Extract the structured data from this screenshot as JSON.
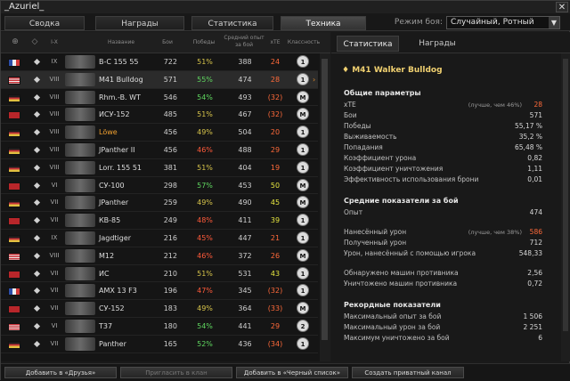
{
  "window": {
    "title": "_Azuriel_",
    "close_label": "✕"
  },
  "tabs": [
    {
      "label": "Сводка"
    },
    {
      "label": "Награды"
    },
    {
      "label": "Статистика"
    },
    {
      "label": "Техника"
    }
  ],
  "mode": {
    "label": "Режим боя:",
    "value": "Случайный, Ротный"
  },
  "columns": {
    "nation": "⊕",
    "type": "◇",
    "tier": "I-X",
    "name": "Название",
    "battles": "Бои",
    "wins": "Победы",
    "exp": "Средний опыт за бой",
    "xte": "xTE",
    "class": "Классность"
  },
  "rows": [
    {
      "flag": "fr",
      "tier": "IX",
      "name": "B-C 155 55",
      "battles": "722",
      "wins": "51%",
      "wins_color": "#d6c34a",
      "exp": "388",
      "xte": "24",
      "xte_color": "#ff6a3a",
      "badge": "1"
    },
    {
      "flag": "us",
      "tier": "VIII",
      "name": "M41 Bulldog",
      "battles": "571",
      "wins": "55%",
      "wins_color": "#5fd65f",
      "exp": "474",
      "xte": "28",
      "xte_color": "#ff6a3a",
      "badge": "1",
      "selected": true,
      "arrow": "›"
    },
    {
      "flag": "de",
      "tier": "VIII",
      "name": "Rhm.-B. WT",
      "battles": "546",
      "wins": "54%",
      "wins_color": "#5fd65f",
      "exp": "493",
      "xte": "32",
      "xte_color": "#ff6a3a",
      "badge": "M"
    },
    {
      "flag": "su",
      "tier": "VIII",
      "name": "ИСУ-152",
      "battles": "485",
      "wins": "51%",
      "wins_color": "#d6c34a",
      "exp": "467",
      "xte": "32",
      "xte_color": "#ff6a3a",
      "badge": "M"
    },
    {
      "flag": "de",
      "tier": "VIII",
      "name": "Löwe",
      "battles": "456",
      "wins": "49%",
      "wins_color": "#d6c34a",
      "exp": "504",
      "xte": "20",
      "xte_color": "#ff6a3a",
      "badge": "1",
      "name_color": "#f0a030"
    },
    {
      "flag": "de",
      "tier": "VIII",
      "name": "JPanther II",
      "battles": "456",
      "wins": "46%",
      "wins_color": "#ff5a3a",
      "exp": "488",
      "xte": "29",
      "xte_color": "#ff6a3a",
      "badge": "1"
    },
    {
      "flag": "de",
      "tier": "VIII",
      "name": "Lorr. 155 51",
      "battles": "381",
      "wins": "51%",
      "wins_color": "#d6c34a",
      "exp": "404",
      "xte": "19",
      "xte_color": "#ff6a3a",
      "badge": "1"
    },
    {
      "flag": "su",
      "tier": "VI",
      "name": "СУ-100",
      "battles": "298",
      "wins": "57%",
      "wins_color": "#5fd65f",
      "exp": "453",
      "xte": "50",
      "xte_color": "#e6e640",
      "badge": "M"
    },
    {
      "flag": "de",
      "tier": "VII",
      "name": "JPanther",
      "battles": "259",
      "wins": "49%",
      "wins_color": "#d6c34a",
      "exp": "490",
      "xte": "45",
      "xte_color": "#e6e640",
      "badge": "M"
    },
    {
      "flag": "su",
      "tier": "VII",
      "name": "КВ-85",
      "battles": "249",
      "wins": "48%",
      "wins_color": "#ff5a3a",
      "exp": "411",
      "xte": "39",
      "xte_color": "#e6e640",
      "badge": "1"
    },
    {
      "flag": "de",
      "tier": "IX",
      "name": "Jagdtiger",
      "battles": "216",
      "wins": "45%",
      "wins_color": "#ff5a3a",
      "exp": "447",
      "xte": "21",
      "xte_color": "#ff6a3a",
      "badge": "1"
    },
    {
      "flag": "us",
      "tier": "VIII",
      "name": "M12",
      "battles": "212",
      "wins": "46%",
      "wins_color": "#ff5a3a",
      "exp": "372",
      "xte": "26",
      "xte_color": "#ff6a3a",
      "badge": "M"
    },
    {
      "flag": "su",
      "tier": "VII",
      "name": "ИС",
      "battles": "210",
      "wins": "51%",
      "wins_color": "#d6c34a",
      "exp": "531",
      "xte": "43",
      "xte_color": "#e6e640",
      "badge": "1"
    },
    {
      "flag": "fr",
      "tier": "VII",
      "name": "AMX 13 F3",
      "battles": "196",
      "wins": "47%",
      "wins_color": "#ff5a3a",
      "exp": "345",
      "xte": "32",
      "xte_color": "#ff6a3a",
      "badge": "1"
    },
    {
      "flag": "su",
      "tier": "VII",
      "name": "СУ-152",
      "battles": "183",
      "wins": "49%",
      "wins_color": "#d6c34a",
      "exp": "364",
      "xte": "33",
      "xte_color": "#ff6a3a",
      "badge": "M"
    },
    {
      "flag": "us",
      "tier": "VI",
      "name": "T37",
      "battles": "180",
      "wins": "54%",
      "wins_color": "#5fd65f",
      "exp": "441",
      "xte": "29",
      "xte_color": "#ff6a3a",
      "badge": "2"
    },
    {
      "flag": "de",
      "tier": "VII",
      "name": "Panther",
      "battles": "165",
      "wins": "52%",
      "wins_color": "#5fd65f",
      "exp": "436",
      "xte": "34",
      "xte_color": "#ff6a3a",
      "badge": "1"
    }
  ],
  "right": {
    "tabs": [
      {
        "label": "Статистика"
      },
      {
        "label": "Награды"
      }
    ],
    "vehicle": "M41 Walker Bulldog",
    "general": {
      "title": "Общие параметры",
      "items": [
        {
          "label": "xTE",
          "note": "(лучше, чем 46%)",
          "value": "28",
          "value_color": "#ff6a3a"
        },
        {
          "label": "Бои",
          "note": "",
          "value": "571"
        },
        {
          "label": "Победы",
          "note": "",
          "value": "55,17 %"
        },
        {
          "label": "Выживаемость",
          "note": "",
          "value": "35,2 %"
        },
        {
          "label": "Попадания",
          "note": "",
          "value": "65,48 %"
        },
        {
          "label": "Коэффициент урона",
          "note": "",
          "value": "0,82"
        },
        {
          "label": "Коэффициент уничтожения",
          "note": "",
          "value": "1,11"
        },
        {
          "label": "Эффективность использования брони",
          "note": "",
          "value": "0,01"
        }
      ]
    },
    "avg": {
      "title": "Средние показатели за бой",
      "items": [
        {
          "label": "Опыт",
          "note": "",
          "value": "474"
        },
        {
          "label": "Нанесённый урон",
          "note": "(лучше, чем 38%)",
          "value": "586",
          "value_color": "#ff6a3a"
        },
        {
          "label": "Полученный урон",
          "note": "",
          "value": "712"
        },
        {
          "label": "Урон, нанесённый с помощью игрока",
          "note": "",
          "value": "548,33"
        },
        {
          "label": "Обнаружено машин противника",
          "note": "",
          "value": "2,56"
        },
        {
          "label": "Уничтожено машин противника",
          "note": "",
          "value": "0,72"
        }
      ]
    },
    "records": {
      "title": "Рекордные показатели",
      "items": [
        {
          "label": "Максимальный опыт за бой",
          "note": "",
          "value": "1 506"
        },
        {
          "label": "Максимальный урон за бой",
          "note": "",
          "value": "2 251"
        },
        {
          "label": "Максимум уничтожено за бой",
          "note": "",
          "value": "6"
        }
      ]
    }
  },
  "buttons": [
    {
      "label": "Добавить в «Друзья»",
      "disabled": false
    },
    {
      "label": "Пригласить в клан",
      "disabled": true
    },
    {
      "label": "Добавить в «Черный список»",
      "disabled": false
    },
    {
      "label": "Создать приватный канал",
      "disabled": false
    }
  ]
}
